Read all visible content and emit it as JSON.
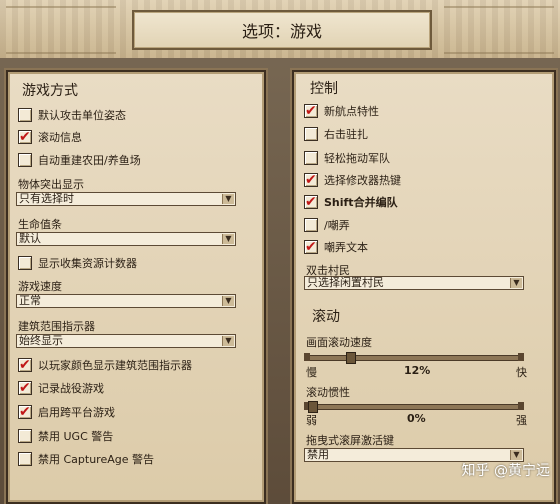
{
  "title": "选项：游戏",
  "left": {
    "section_title": "游戏方式",
    "checkboxes": [
      {
        "label": "默认攻击单位姿态",
        "checked": false
      },
      {
        "label": "滚动信息",
        "checked": true
      },
      {
        "label": "自动重建农田/养鱼场",
        "checked": false
      }
    ],
    "unit_display": {
      "label": "物体突出显示",
      "value": "只有选择时"
    },
    "health_bar": {
      "label": "生命值条",
      "value": "默认"
    },
    "resource_counter": {
      "label": "显示收集资源计数器",
      "checked": false
    },
    "game_speed": {
      "label": "游戏速度",
      "value": "正常"
    },
    "build_range": {
      "label": "建筑范围指示器",
      "value": "始终显示"
    },
    "more_checkboxes": [
      {
        "label": "以玩家颜色显示建筑范围指示器",
        "checked": true
      },
      {
        "label": "记录战役游戏",
        "checked": true
      },
      {
        "label": "启用跨平台游戏",
        "checked": true
      },
      {
        "label": "禁用 UGC 警告",
        "checked": false
      },
      {
        "label": "禁用 CaptureAge 警告",
        "checked": false
      }
    ]
  },
  "right": {
    "section_title": "控制",
    "checkboxes": [
      {
        "label": "新航点特性",
        "checked": true
      },
      {
        "label": "右击驻扎",
        "checked": false
      },
      {
        "label": "轻松拖动军队",
        "checked": false
      },
      {
        "label": "选择修改器热键",
        "checked": true
      },
      {
        "label": "Shift合并编队",
        "checked": true
      },
      {
        "label": "/嘲弄",
        "checked": false
      },
      {
        "label": "嘲弄文本",
        "checked": true
      }
    ],
    "double_click": {
      "label": "双击村民",
      "value": "只选择闲置村民"
    },
    "scroll_title": "滚动",
    "scroll_speed": {
      "label": "画面滚动速度",
      "min": "慢",
      "max": "快",
      "value_text": "12%",
      "value": 0.12
    },
    "scroll_inertia": {
      "label": "滚动惯性",
      "min": "弱",
      "max": "强",
      "value_text": "0%",
      "value": 0.0
    },
    "edge_scroll": {
      "label": "拖曳式滚屏激活键",
      "value": "禁用"
    }
  },
  "watermark": "知乎 @黄宁远",
  "colors": {
    "check": "#c01818",
    "panel": "#e9dcc4",
    "border": "#3c2e20"
  }
}
